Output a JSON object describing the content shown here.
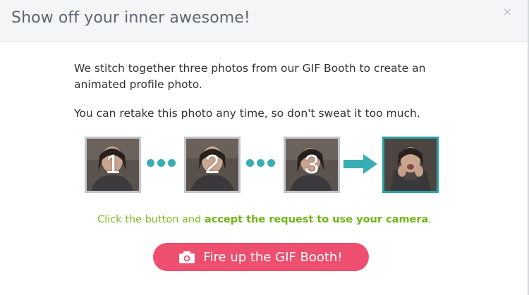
{
  "modal": {
    "title": "Show off your inner awesome!",
    "close_glyph": "×",
    "close_icon": "close-icon"
  },
  "body": {
    "paragraph1": "We stitch together three photos from our GIF Booth to create an animated profile photo.",
    "paragraph2": "You can retake this photo any time, so don't sweat it too much."
  },
  "steps": {
    "frames": [
      {
        "label": "1"
      },
      {
        "label": "2"
      },
      {
        "label": "3"
      }
    ],
    "result_icon": "arrow-right-icon"
  },
  "cta": {
    "prefix": "Click the button and ",
    "emphasis": "accept the request to use your camera",
    "suffix": "."
  },
  "button": {
    "label": "Fire up the GIF Booth!",
    "icon": "camera-icon"
  },
  "colors": {
    "accent_teal": "#39aeb2",
    "button_pink": "#ee4e6f",
    "cta_green": "#7cbd1e"
  }
}
